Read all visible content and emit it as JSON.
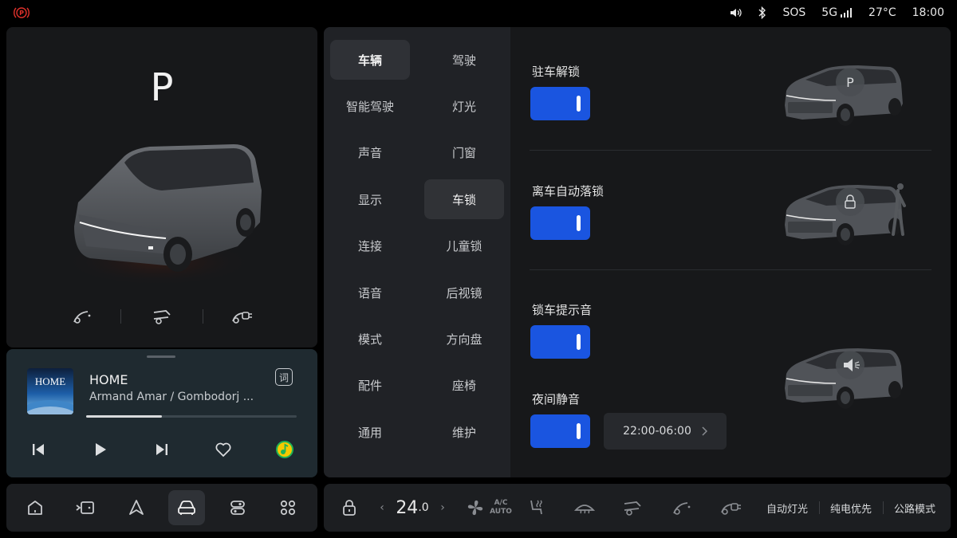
{
  "status": {
    "sos": "SOS",
    "network": "5G",
    "temperature": "27°C",
    "time": "18:00",
    "icons": [
      "park-brake-icon",
      "volume-icon",
      "bluetooth-icon",
      "signal-icon"
    ],
    "park_brake_color": "#e0312b"
  },
  "vehicle": {
    "gear": "P",
    "actions": [
      "hood-icon",
      "tailgate-icon",
      "charge-port-icon"
    ]
  },
  "media": {
    "album_text": "HOME",
    "title": "HOME",
    "artist": "Armand Amar / Gombodorj ...",
    "lyric_label": "词",
    "progress": 0.36,
    "controls": [
      "previous-icon",
      "play-icon",
      "next-icon",
      "heart-icon",
      "qq-music-icon"
    ]
  },
  "settings": {
    "menu_left": [
      "车辆",
      "智能驾驶",
      "声音",
      "显示",
      "连接",
      "语音",
      "模式",
      "配件",
      "通用"
    ],
    "menu_right": [
      "驾驶",
      "灯光",
      "门窗",
      "车锁",
      "儿童锁",
      "后视镜",
      "方向盘",
      "座椅",
      "维护"
    ],
    "active_left_index": 0,
    "selected_right_index": 3,
    "items": [
      {
        "label": "驻车解锁",
        "enabled": true
      },
      {
        "label": "离车自动落锁",
        "enabled": true
      },
      {
        "label": "锁车提示音",
        "enabled": true
      },
      {
        "label": "夜间静音",
        "enabled": true
      }
    ],
    "night_time": "22:00-06:00",
    "accent": "#1a55e0"
  },
  "dock": {
    "items": [
      "home-icon",
      "screen-cast-icon",
      "navigation-icon",
      "vehicle-icon",
      "toggle-settings-icon",
      "apps-grid-icon"
    ],
    "active_index": 3
  },
  "climate": {
    "temp_int": "24",
    "temp_dec": ".0",
    "ac_top": "A/C",
    "ac_bottom": "AUTO",
    "auto_light": "自动灯光",
    "ev_priority": "纯电优先",
    "road_mode": "公路模式"
  }
}
